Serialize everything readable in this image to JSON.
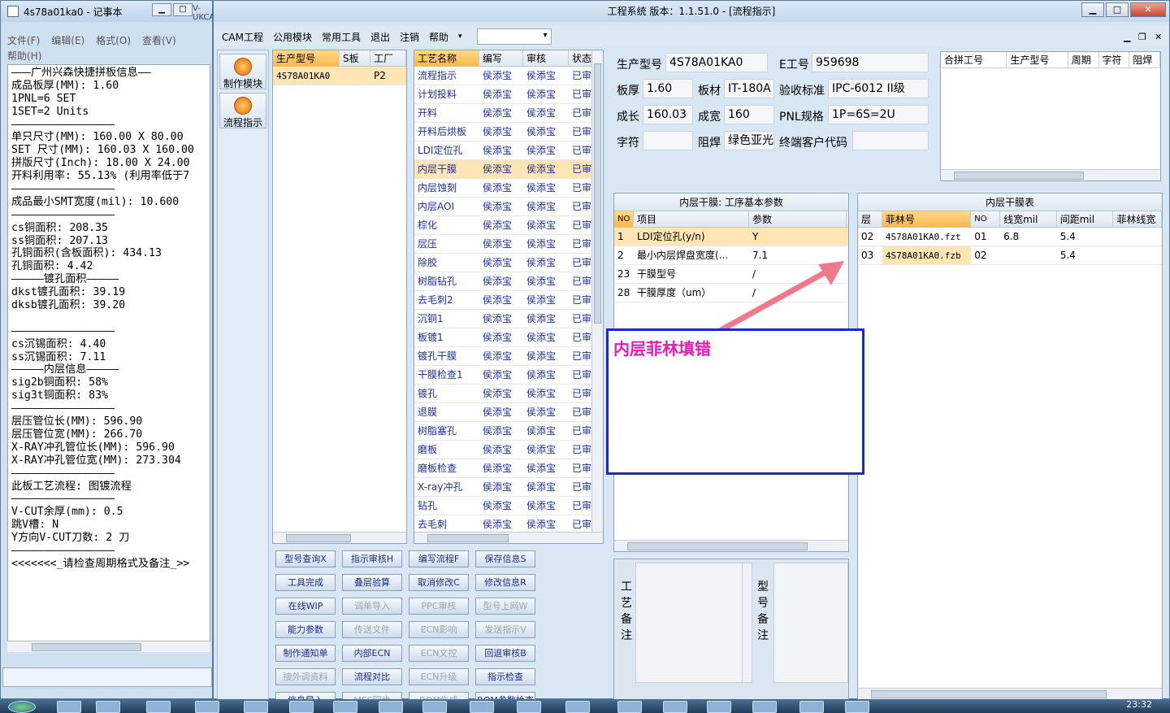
{
  "notepad": {
    "title": "4s78a01ka0 - 记事本",
    "menu": [
      "文件(F)",
      "编辑(E)",
      "格式(O)",
      "查看(V)",
      "帮助(H)"
    ],
    "background_title": "V-UKCAM",
    "lines": [
      "———广州兴森快捷拼板信息——",
      "成品板厚(MM): 1.60",
      "1PNL=6 SET",
      "1SET=2 Units",
      "————————————————",
      "单只尺寸(MM): 160.00 X 80.00",
      "SET 尺寸(MM): 160.03 X 160.00",
      "拼版尺寸(Inch): 18.00 X 24.00",
      "开料利用率: 55.13% (利用率低于7",
      "————————————————",
      "成品最小SMT宽度(mil): 10.600",
      "————————————————",
      "cs铜面积: 208.35",
      "ss铜面积: 207.13",
      "孔铜面积(含板面积): 434.13",
      "孔铜面积: 4.42",
      "—————镀孔面积—————",
      "dkst镀孔面积: 39.19",
      "dksb镀孔面积: 39.20",
      "",
      "————————————————",
      "cs沉锡面积: 4.40",
      "ss沉锡面积: 7.11",
      "—————内层信息—————",
      "sig2b铜面积: 58%",
      "sig3t铜面积: 83%",
      "————————————————",
      "层压管位长(MM): 596.90",
      "层压管位宽(MM): 266.70",
      "X-RAY冲孔管位长(MM): 596.90",
      "X-RAY冲孔管位宽(MM): 273.304",
      "————————————————",
      "此板工艺流程: 图镀流程",
      "————————————————",
      "V-CUT余厚(mm): 0.5",
      "跳V槽: N",
      "Y方向V-CUT刀数: 2 刀",
      "————————————————",
      "<<<<<<<_请检查周期格式及备注_>>"
    ]
  },
  "main": {
    "title": "工程系统  版本：1.1.51.0 - [流程指示]",
    "menu": [
      "CAM工程",
      "公用模块",
      "常用工具",
      "退出",
      "注销",
      "帮助"
    ],
    "combo_value": "",
    "side_nav": [
      {
        "label": "制作模块"
      },
      {
        "label": "流程指示"
      }
    ],
    "model_grid": {
      "headers": [
        "生产型号",
        "S板",
        "工厂"
      ],
      "rows": [
        [
          "4S78A01KA0",
          "",
          "P2"
        ]
      ]
    },
    "process_grid": {
      "headers": [
        "工艺名称",
        "编写",
        "审核",
        "状态"
      ],
      "rows": [
        [
          "流程指示",
          "侯添宝",
          "侯添宝",
          "已审"
        ],
        [
          "计划投料",
          "侯添宝",
          "侯添宝",
          "已审"
        ],
        [
          "开料",
          "侯添宝",
          "侯添宝",
          "已审"
        ],
        [
          "开料后烘板",
          "侯添宝",
          "侯添宝",
          "已审"
        ],
        [
          "LDI定位孔",
          "侯添宝",
          "侯添宝",
          "已审"
        ],
        [
          "内层干膜",
          "侯添宝",
          "侯添宝",
          "已审"
        ],
        [
          "内层蚀刻",
          "侯添宝",
          "侯添宝",
          "已审"
        ],
        [
          "内层AOI",
          "侯添宝",
          "侯添宝",
          "已审"
        ],
        [
          "棕化",
          "侯添宝",
          "侯添宝",
          "已审"
        ],
        [
          "层压",
          "侯添宝",
          "侯添宝",
          "已审"
        ],
        [
          "除胶",
          "侯添宝",
          "侯添宝",
          "已审"
        ],
        [
          "树脂钻孔",
          "侯添宝",
          "侯添宝",
          "已审"
        ],
        [
          "去毛刺2",
          "侯添宝",
          "侯添宝",
          "已审"
        ],
        [
          "沉铜1",
          "侯添宝",
          "侯添宝",
          "已审"
        ],
        [
          "板镀1",
          "侯添宝",
          "侯添宝",
          "已审"
        ],
        [
          "镀孔干膜",
          "侯添宝",
          "侯添宝",
          "已审"
        ],
        [
          "干膜检查1",
          "侯添宝",
          "侯添宝",
          "已审"
        ],
        [
          "镀孔",
          "侯添宝",
          "侯添宝",
          "已审"
        ],
        [
          "退膜",
          "侯添宝",
          "侯添宝",
          "已审"
        ],
        [
          "树脂塞孔",
          "侯添宝",
          "侯添宝",
          "已审"
        ],
        [
          "磨板",
          "侯添宝",
          "侯添宝",
          "已审"
        ],
        [
          "磨板检查",
          "侯添宝",
          "侯添宝",
          "已审"
        ],
        [
          "X-ray冲孔",
          "侯添宝",
          "侯添宝",
          "已审"
        ],
        [
          "钻孔",
          "侯添宝",
          "侯添宝",
          "已审"
        ],
        [
          "去毛刺",
          "侯添宝",
          "侯添宝",
          "已审"
        ]
      ],
      "selected_index": 5
    },
    "info": {
      "production_model_label": "生产型号",
      "production_model": "4S78A01KA0",
      "e_no_label": "E工号",
      "e_no": "959698",
      "thickness_label": "板厚",
      "thickness": "1.60",
      "material_label": "板材",
      "material": "IT-180A",
      "standard_label": "验收标准",
      "standard": "IPC-6012 II级",
      "length_label": "成长",
      "length": "160.03",
      "width_label": "成宽",
      "width": "160",
      "pnl_label": "PNL规格",
      "pnl": "1P=6S=2U",
      "char_label": "字符",
      "char": "",
      "mask_label": "阻焊",
      "mask": "绿色亚光",
      "customer_label": "终端客户代码",
      "customer": ""
    },
    "merge_grid": {
      "headers": [
        "合拼工号",
        "生产型号",
        "周期",
        "字符",
        "阻焊"
      ]
    },
    "params_panel": {
      "title": "内层干膜: 工序基本参数",
      "headers": [
        "NO",
        "项目",
        "参数"
      ],
      "rows": [
        [
          "1",
          "LDI定位孔(y/n)",
          "Y"
        ],
        [
          "2",
          "最小内层焊盘宽度(...",
          "7.1"
        ],
        [
          "23",
          "干膜型号",
          "/"
        ],
        [
          "28",
          "干膜厚度（um）",
          "/"
        ]
      ]
    },
    "film_panel": {
      "title": "内层干膜表",
      "headers": [
        "层",
        "菲林号",
        "NO",
        "线宽mil",
        "间距mil",
        "菲林线宽"
      ],
      "rows": [
        [
          "02",
          "4S78A01KA0.fzt",
          "01",
          "6.8",
          "5.4",
          ""
        ],
        [
          "03",
          "4S78A01KA0.fzb",
          "02",
          "",
          "5.4",
          ""
        ]
      ]
    },
    "callout": {
      "text": "内层菲林填错",
      "color": "#e91ab6",
      "border": "#1a2bc4"
    },
    "buttons": [
      {
        "label": "型号查询X",
        "enabled": true
      },
      {
        "label": "指示审核H",
        "enabled": true
      },
      {
        "label": "编写流程F",
        "enabled": true
      },
      {
        "label": "保存信息S",
        "enabled": true
      },
      {
        "label": "工具完成",
        "enabled": true
      },
      {
        "label": "叠层验算",
        "enabled": true
      },
      {
        "label": "取消修改C",
        "enabled": true
      },
      {
        "label": "修改信息R",
        "enabled": true
      },
      {
        "label": "在线WIP",
        "enabled": true
      },
      {
        "label": "调单导入",
        "enabled": false
      },
      {
        "label": "PPC审核",
        "enabled": false
      },
      {
        "label": "型号上网W",
        "enabled": false
      },
      {
        "label": "能力参数",
        "enabled": true
      },
      {
        "label": "传送文件",
        "enabled": false
      },
      {
        "label": "ECN影响",
        "enabled": false
      },
      {
        "label": "发送指示V",
        "enabled": false
      },
      {
        "label": "制作通知单",
        "enabled": true
      },
      {
        "label": "内部ECN",
        "enabled": true
      },
      {
        "label": "ECN文控",
        "enabled": false
      },
      {
        "label": "回退审核B",
        "enabled": true
      },
      {
        "label": "接外调资料",
        "enabled": false
      },
      {
        "label": "流程对比",
        "enabled": true
      },
      {
        "label": "ECN升级",
        "enabled": false
      },
      {
        "label": "指示检查",
        "enabled": true
      },
      {
        "label": "信息导入",
        "enabled": true
      },
      {
        "label": "MES同步",
        "enabled": false
      },
      {
        "label": "ROM生成",
        "enabled": false
      },
      {
        "label": "ROM参数检查",
        "enabled": true
      }
    ],
    "process_memo_label": "工艺备注",
    "model_memo_label": "型号备注"
  },
  "taskbar": {
    "clock": "23:32"
  },
  "colors": {
    "accent": "#f8b94a",
    "selected_row": "#fde6b4",
    "link_text": "#1c2f9c",
    "arrow": "#f07a8c"
  }
}
